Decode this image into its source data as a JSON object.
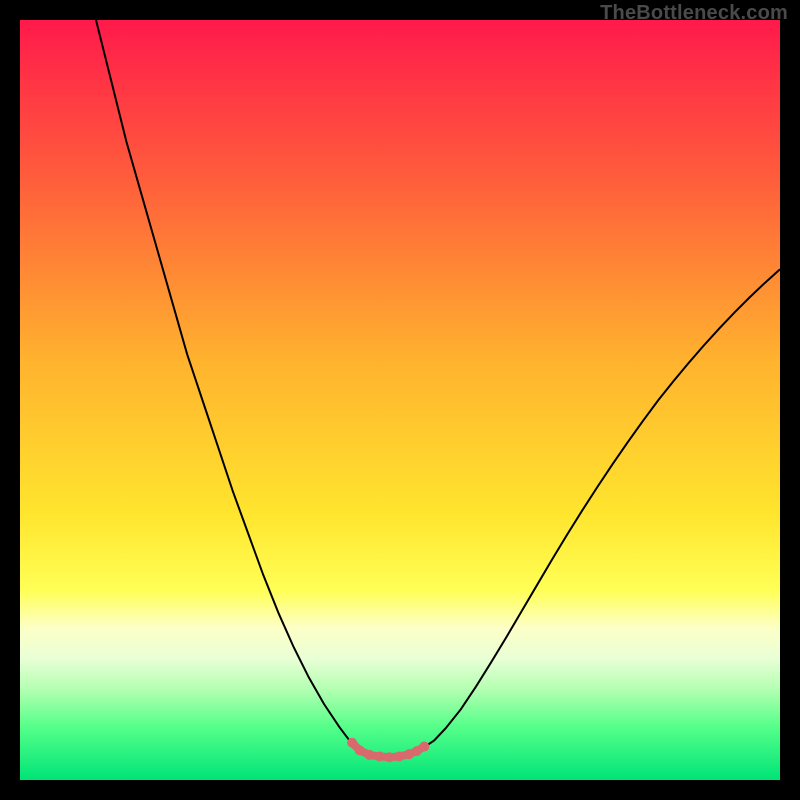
{
  "watermark": "TheBottleneck.com",
  "chart_data": {
    "type": "line",
    "title": "",
    "xlabel": "",
    "ylabel": "",
    "xlim": [
      0,
      100
    ],
    "ylim": [
      0,
      100
    ],
    "gradient_stops": [
      {
        "offset": 0,
        "color": "#ff1a4b"
      },
      {
        "offset": 20,
        "color": "#ff5a3c"
      },
      {
        "offset": 45,
        "color": "#ffb32e"
      },
      {
        "offset": 65,
        "color": "#ffe52e"
      },
      {
        "offset": 75,
        "color": "#ffff56"
      },
      {
        "offset": 80,
        "color": "#fdffc7"
      },
      {
        "offset": 84,
        "color": "#e9ffd6"
      },
      {
        "offset": 88,
        "color": "#b4ffb2"
      },
      {
        "offset": 93,
        "color": "#55ff8a"
      },
      {
        "offset": 100,
        "color": "#00e477"
      }
    ],
    "series": [
      {
        "name": "bottleneck-curve",
        "stroke": "#000000",
        "stroke_width": 2,
        "path_xy": [
          [
            10,
            100
          ],
          [
            12,
            92
          ],
          [
            14,
            84
          ],
          [
            16,
            77
          ],
          [
            18,
            70
          ],
          [
            20,
            63
          ],
          [
            22,
            56
          ],
          [
            24,
            50
          ],
          [
            26,
            44
          ],
          [
            28,
            38
          ],
          [
            30,
            32.5
          ],
          [
            32,
            27
          ],
          [
            34,
            22
          ],
          [
            36,
            17.5
          ],
          [
            38,
            13.5
          ],
          [
            40,
            10
          ],
          [
            42,
            7
          ],
          [
            43.5,
            5
          ],
          [
            44.5,
            4
          ],
          [
            45,
            3.6
          ],
          [
            46,
            3.2
          ],
          [
            47,
            3.1
          ],
          [
            48,
            3.0
          ],
          [
            49,
            3.0
          ],
          [
            50,
            3.1
          ],
          [
            51,
            3.3
          ],
          [
            52,
            3.6
          ],
          [
            53,
            4.2
          ],
          [
            54.5,
            5.2
          ],
          [
            56,
            6.8
          ],
          [
            58,
            9.3
          ],
          [
            60,
            12.3
          ],
          [
            62,
            15.5
          ],
          [
            64,
            18.8
          ],
          [
            66,
            22.2
          ],
          [
            68,
            25.6
          ],
          [
            70,
            29
          ],
          [
            72,
            32.3
          ],
          [
            74,
            35.5
          ],
          [
            76,
            38.6
          ],
          [
            78,
            41.6
          ],
          [
            80,
            44.5
          ],
          [
            82,
            47.3
          ],
          [
            84,
            50
          ],
          [
            86,
            52.5
          ],
          [
            88,
            54.9
          ],
          [
            90,
            57.2
          ],
          [
            92,
            59.4
          ],
          [
            94,
            61.5
          ],
          [
            96,
            63.5
          ],
          [
            98,
            65.4
          ],
          [
            100,
            67.2
          ]
        ]
      },
      {
        "name": "optimal-range",
        "stroke": "#d86a6e",
        "stroke_width": 8,
        "dots": [
          {
            "x": 43.7,
            "y": 4.9
          },
          {
            "x": 44.7,
            "y": 3.9
          },
          {
            "x": 46.0,
            "y": 3.3
          },
          {
            "x": 47.3,
            "y": 3.1
          },
          {
            "x": 48.6,
            "y": 3.0
          },
          {
            "x": 49.9,
            "y": 3.1
          },
          {
            "x": 51.2,
            "y": 3.4
          },
          {
            "x": 52.2,
            "y": 3.8
          },
          {
            "x": 53.2,
            "y": 4.4
          }
        ],
        "path_xy": [
          [
            43.7,
            4.9
          ],
          [
            44.7,
            3.9
          ],
          [
            46.0,
            3.3
          ],
          [
            47.3,
            3.1
          ],
          [
            48.6,
            3.0
          ],
          [
            49.9,
            3.1
          ],
          [
            51.2,
            3.4
          ],
          [
            52.2,
            3.8
          ],
          [
            53.2,
            4.4
          ]
        ]
      }
    ]
  }
}
